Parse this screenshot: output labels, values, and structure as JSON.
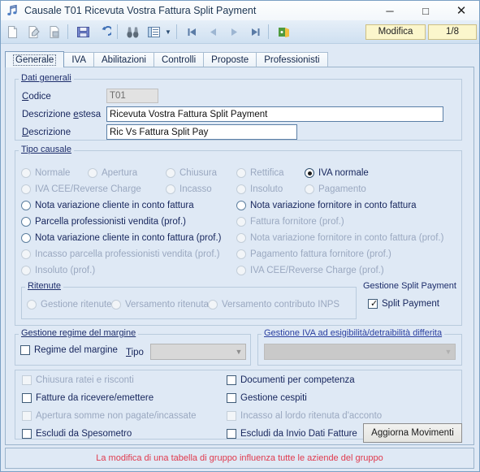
{
  "window": {
    "title": "Causale T01 Ricevuta Vostra Fattura Split Payment",
    "icon": "music-note-icon",
    "minimize": "─",
    "maximize": "□",
    "close": "✕"
  },
  "toolbar": {
    "icons": [
      "new-document-icon",
      "edit-document-icon",
      "save-document-icon",
      "save-icon",
      "undo-icon",
      "find-icon",
      "list-icon",
      "dropdown-caret-icon",
      "first-record-icon",
      "prev-record-icon",
      "next-record-icon",
      "last-record-icon",
      "exit-icon"
    ],
    "status_mode": "Modifica",
    "record_counter": "1/8"
  },
  "tabs": [
    {
      "label": "Generale",
      "active": true
    },
    {
      "label": "IVA",
      "active": false
    },
    {
      "label": "Abilitazioni",
      "active": false
    },
    {
      "label": "Controlli",
      "active": false
    },
    {
      "label": "Proposte",
      "active": false
    },
    {
      "label": "Professionisti",
      "active": false
    }
  ],
  "dati_generali": {
    "group_title": "Dati generali",
    "codice_label": "Codice",
    "codice_value": "T01",
    "descrizione_estesa_label": "Descrizione estesa",
    "descrizione_estesa_value": "Ricevuta Vostra Fattura Split Payment",
    "descrizione_label": "Descrizione",
    "descrizione_value": "Ric Vs Fattura Split Pay"
  },
  "tipo_causale": {
    "group_title": "Tipo causale",
    "options": [
      {
        "label": "Normale",
        "checked": false,
        "enabled": false
      },
      {
        "label": "Apertura",
        "checked": false,
        "enabled": false
      },
      {
        "label": "Chiusura",
        "checked": false,
        "enabled": false
      },
      {
        "label": "Rettifica",
        "checked": false,
        "enabled": false
      },
      {
        "label": "IVA normale",
        "checked": true,
        "enabled": true
      },
      {
        "label": "IVA CEE/Reverse Charge",
        "checked": false,
        "enabled": false
      },
      {
        "label": "Incasso",
        "checked": false,
        "enabled": false
      },
      {
        "label": "Insoluto",
        "checked": false,
        "enabled": false
      },
      {
        "label": "Pagamento",
        "checked": false,
        "enabled": false
      },
      {
        "label": "Nota variazione cliente in conto fattura",
        "checked": false,
        "enabled": true
      },
      {
        "label": "Nota variazione fornitore in conto fattura",
        "checked": false,
        "enabled": true
      },
      {
        "label": "Parcella professionisti vendita (prof.)",
        "checked": false,
        "enabled": true
      },
      {
        "label": "Fattura fornitore (prof.)",
        "checked": false,
        "enabled": false
      },
      {
        "label": "Nota variazione cliente in conto fattura (prof.)",
        "checked": false,
        "enabled": true
      },
      {
        "label": "Nota variazione fornitore in conto fattura (prof.)",
        "checked": false,
        "enabled": false
      },
      {
        "label": "Incasso parcella professionisti vendita (prof.)",
        "checked": false,
        "enabled": false
      },
      {
        "label": "Pagamento fattura fornitore (prof.)",
        "checked": false,
        "enabled": false
      },
      {
        "label": "Insoluto (prof.)",
        "checked": false,
        "enabled": false
      },
      {
        "label": "IVA CEE/Reverse Charge (prof.)",
        "checked": false,
        "enabled": false
      }
    ]
  },
  "ritenute": {
    "group_title": "Ritenute",
    "options": [
      {
        "label": "Gestione ritenute",
        "checked": false,
        "enabled": false
      },
      {
        "label": "Versamento ritenuta",
        "checked": false,
        "enabled": false
      },
      {
        "label": "Versamento contributo INPS",
        "checked": false,
        "enabled": false
      }
    ]
  },
  "split_payment": {
    "group_title": "Gestione Split Payment",
    "checkbox_label": "Split Payment",
    "checked": true
  },
  "regime_margine": {
    "group_title": "Gestione regime del margine",
    "checkbox_label": "Regime del margine",
    "checked": false,
    "tipo_label": "Tipo",
    "tipo_value": ""
  },
  "iva_differita": {
    "group_title": "Gestione IVA ad esigibilità/detraibilità differita",
    "value": ""
  },
  "flags": [
    {
      "label": "Chiusura ratei e risconti",
      "checked": false,
      "enabled": false
    },
    {
      "label": "Documenti per competenza",
      "checked": false,
      "enabled": true
    },
    {
      "label": "Fatture da ricevere/emettere",
      "checked": false,
      "enabled": true
    },
    {
      "label": "Gestione cespiti",
      "checked": false,
      "enabled": true
    },
    {
      "label": "Apertura somme non pagate/incassate",
      "checked": false,
      "enabled": false
    },
    {
      "label": "Incasso al lordo ritenuta d'acconto",
      "checked": false,
      "enabled": false
    },
    {
      "label": "Escludi da Spesometro",
      "checked": false,
      "enabled": true
    },
    {
      "label": "Escludi da Invio Dati Fatture",
      "checked": false,
      "enabled": true
    }
  ],
  "aggiorna_button": "Aggiorna Movimenti",
  "footer_message": "La modifica di una tabella di gruppo influenza tutte le aziende del gruppo",
  "colors": {
    "accent_blue": "#1d2d6b",
    "panel_bg": "#dfe9f5",
    "status_yellow": "#fbf6cc",
    "warning_red": "#e03a4e",
    "group_title_alt": "#2a3fa0"
  }
}
